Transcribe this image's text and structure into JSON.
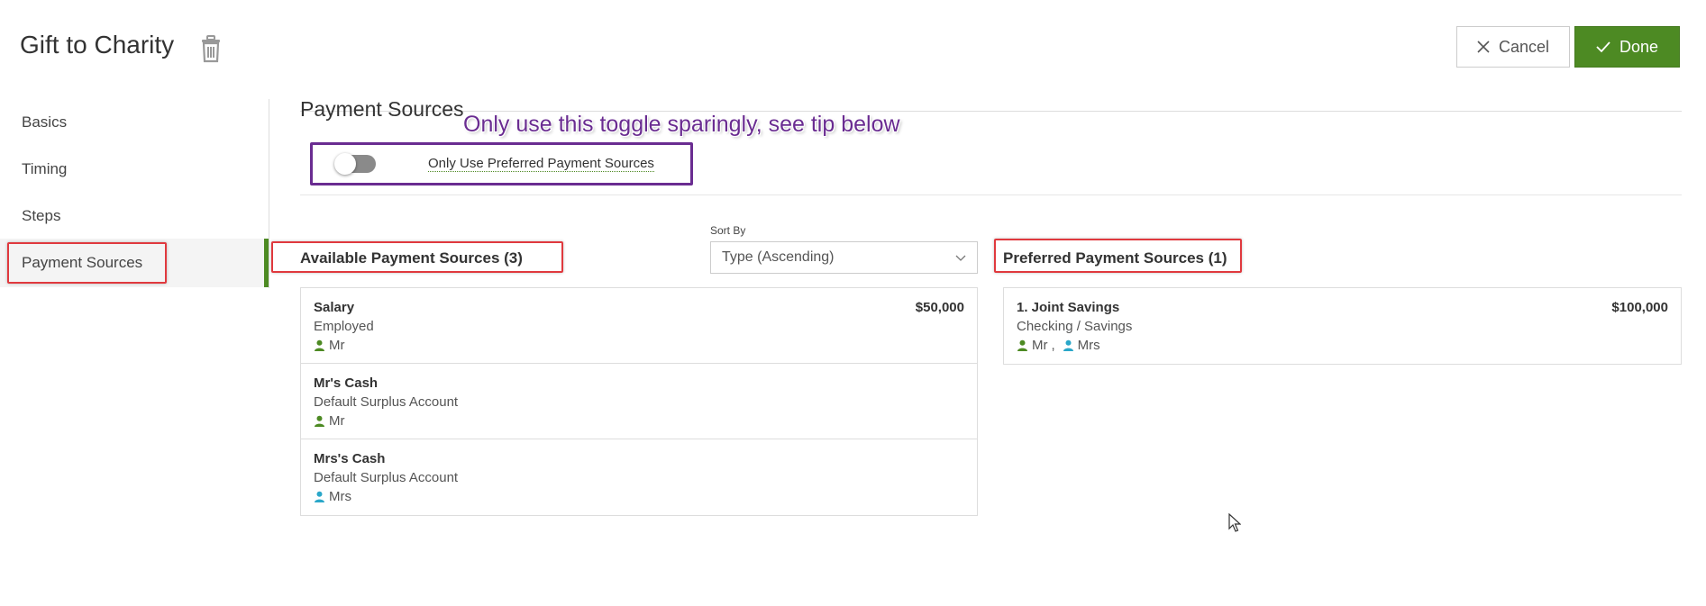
{
  "header": {
    "title": "Gift to Charity",
    "cancel_label": "Cancel",
    "done_label": "Done"
  },
  "sidebar": {
    "items": [
      {
        "label": "Basics"
      },
      {
        "label": "Timing"
      },
      {
        "label": "Steps"
      },
      {
        "label": "Payment Sources"
      }
    ],
    "active": "Payment Sources"
  },
  "section": {
    "title": "Payment Sources",
    "annotation": "Only use this toggle sparingly, see tip below",
    "toggle_label": "Only Use Preferred Payment Sources",
    "toggle_on": false
  },
  "available": {
    "heading": "Available Payment Sources (3)",
    "sort_label": "Sort By",
    "sort_value": "Type (Ascending)",
    "items": [
      {
        "name": "Salary",
        "type": "Employed",
        "owners": [
          {
            "label": "Mr",
            "color": "#4d8a23"
          }
        ],
        "amount": "$50,000"
      },
      {
        "name": "Mr's Cash",
        "type": "Default Surplus Account",
        "owners": [
          {
            "label": "Mr",
            "color": "#4d8a23"
          }
        ],
        "amount": ""
      },
      {
        "name": "Mrs's Cash",
        "type": "Default Surplus Account",
        "owners": [
          {
            "label": "Mrs",
            "color": "#2aa7c9"
          }
        ],
        "amount": ""
      }
    ]
  },
  "preferred": {
    "heading": "Preferred Payment Sources (1)",
    "items": [
      {
        "name": "1. Joint Savings",
        "type": "Checking / Savings",
        "owners": [
          {
            "label": "Mr",
            "color": "#4d8a23"
          },
          {
            "label": "Mrs",
            "color": "#2aa7c9"
          }
        ],
        "amount": "$100,000"
      }
    ]
  },
  "colors": {
    "accent": "#4d8a23",
    "highlight_red": "#e0393e",
    "highlight_purple": "#6a2c91",
    "mr": "#4d8a23",
    "mrs": "#2aa7c9"
  }
}
